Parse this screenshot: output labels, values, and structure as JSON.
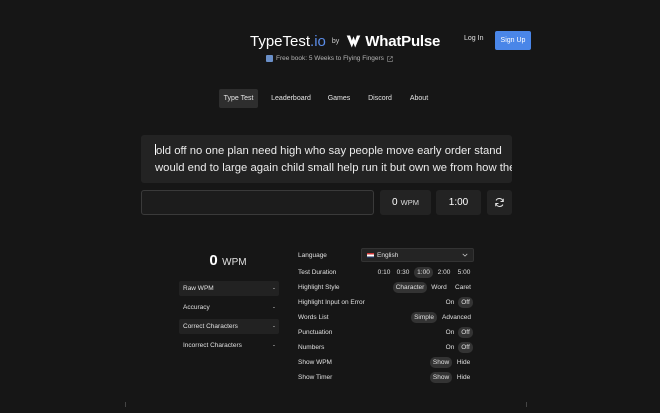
{
  "header": {
    "logo_main": "TypeTest",
    "logo_io": ".io",
    "logo_by": "by",
    "logo_brand": "WhatPulse",
    "login_label": "Log In",
    "signup_label": "Sign Up",
    "freebook_label": "Free book: 5 Weeks to Flying Fingers"
  },
  "nav": {
    "items": [
      {
        "label": "Type Test"
      },
      {
        "label": "Leaderboard"
      },
      {
        "label": "Games"
      },
      {
        "label": "Discord"
      },
      {
        "label": "About"
      }
    ],
    "active": "Type Test"
  },
  "test": {
    "line1": "old off no one plan need high who say people move early order stand",
    "line2": "would end to large again child small help run it but own we from how they",
    "wpm_value": "0",
    "wpm_unit": "WPM",
    "timer": "1:00",
    "input_value": ""
  },
  "stats": {
    "wpm_value": "0",
    "wpm_unit": "WPM",
    "rows": [
      {
        "label": "Raw WPM",
        "value": "-"
      },
      {
        "label": "Accuracy",
        "value": "-"
      },
      {
        "label": "Correct Characters",
        "value": "-"
      },
      {
        "label": "Incorrect Characters",
        "value": "-"
      }
    ]
  },
  "settings": {
    "language": {
      "label": "Language",
      "value": "English"
    },
    "duration": {
      "label": "Test Duration",
      "options": [
        "0:10",
        "0:30",
        "1:00",
        "2:00",
        "5:00"
      ],
      "selected": "1:00"
    },
    "highlight_style": {
      "label": "Highlight Style",
      "options": [
        "Character",
        "Word",
        "Caret"
      ],
      "selected": "Character"
    },
    "highlight_input": {
      "label": "Highlight Input on Error",
      "options": [
        "On",
        "Off"
      ],
      "selected": "Off"
    },
    "words_list": {
      "label": "Words List",
      "options": [
        "Simple",
        "Advanced"
      ],
      "selected": "Simple"
    },
    "punctuation": {
      "label": "Punctuation",
      "options": [
        "On",
        "Off"
      ],
      "selected": "Off"
    },
    "numbers": {
      "label": "Numbers",
      "options": [
        "On",
        "Off"
      ],
      "selected": "Off"
    },
    "show_wpm": {
      "label": "Show WPM",
      "options": [
        "Show",
        "Hide"
      ],
      "selected": "Show"
    },
    "show_timer": {
      "label": "Show Timer",
      "options": [
        "Show",
        "Hide"
      ],
      "selected": "Show"
    }
  },
  "colors": {
    "background": "#161616",
    "panel": "#232323",
    "accent": "#4a86e8",
    "logo_io": "#5b8de8"
  },
  "icons": {
    "brand": "whatpulse-logo-icon",
    "book": "book-icon",
    "external": "external-link-icon",
    "refresh": "refresh-icon",
    "flag": "uk-flag-icon",
    "dropdown": "chevron-down-icon"
  }
}
